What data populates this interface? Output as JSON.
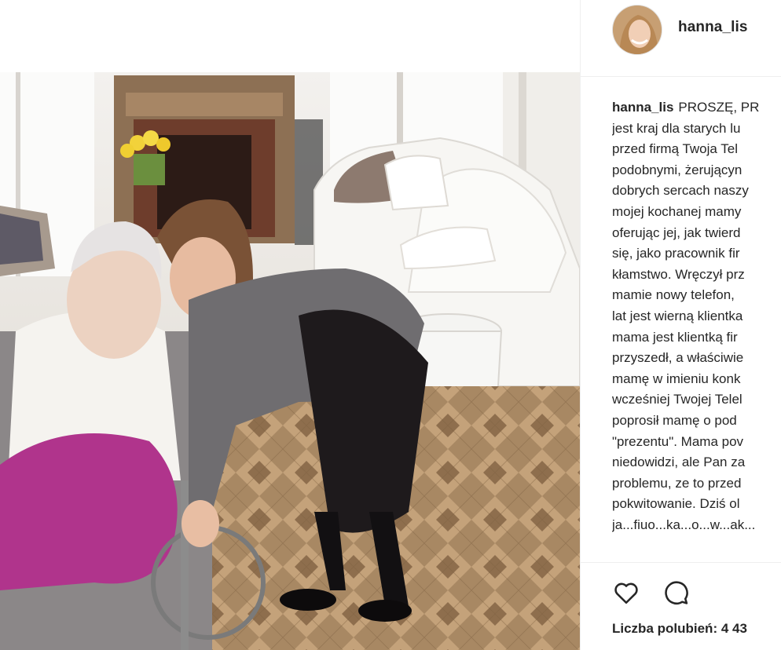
{
  "post": {
    "username": "hanna_lis",
    "caption_lines": [
      "PROSZĘ, PR",
      "jest kraj dla starych lu",
      "przed firmą Twoja Tel",
      "podobnymi, żerującyn",
      "dobrych sercach naszy",
      "mojej kochanej mamy",
      "oferując jej, jak twierd",
      "się, jako pracownik fir",
      "kłamstwo. Wręczył prz",
      "mamie nowy telefon,",
      "lat jest wierną klientka",
      "mama jest klientką fir",
      "przyszedł, a właściwie",
      "mamę w imieniu konk",
      "wcześniej Twojej Telel",
      "poprosił mamę o pod",
      "\"prezentu\". Mama pov",
      "niedowidzi, ale Pan za",
      "problemu, ze to przed",
      "pokwitowanie. Dziś ol",
      "ja...fiuo...ka...o...w...ak..."
    ],
    "likes_label": "Liczba polubień: 4 43",
    "icons": {
      "like": "heart-icon",
      "comment": "comment-bubble-icon"
    }
  },
  "colors": {
    "text": "#262626",
    "border": "#efefef",
    "background": "#ffffff"
  }
}
